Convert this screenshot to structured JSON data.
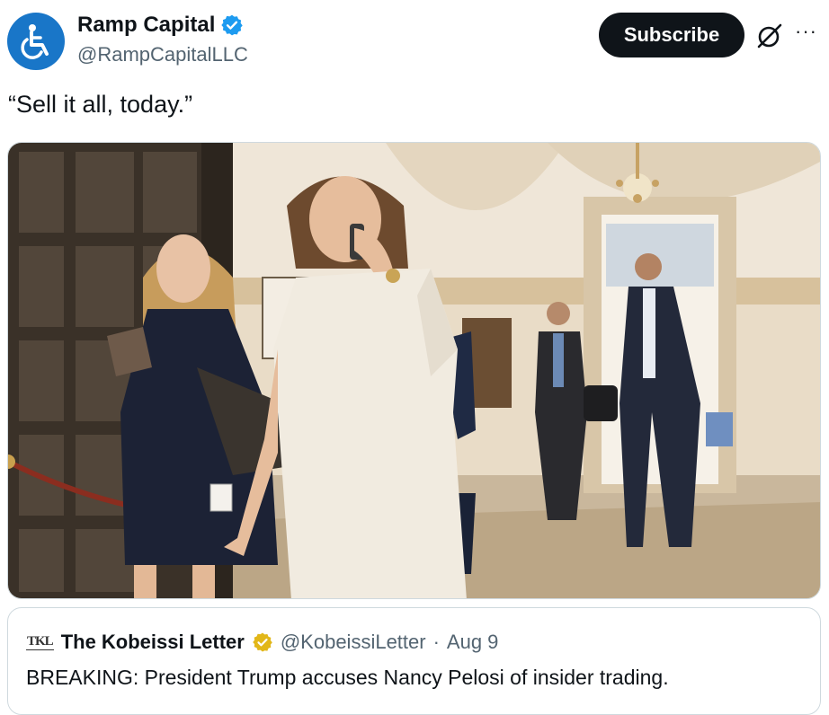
{
  "author": {
    "display_name": "Ramp Capital",
    "handle": "@RampCapitalLLC",
    "avatar_icon": "wheelchair-icon",
    "avatar_color": "#1976c8",
    "verified_color": "#1d9bf0"
  },
  "actions": {
    "subscribe_label": "Subscribe",
    "more_label": "···"
  },
  "tweet": {
    "text": "“Sell it all, today.”"
  },
  "media": {
    "kind": "photo"
  },
  "quote": {
    "logo_text": "TKL",
    "display_name": "The Kobeissi Letter",
    "handle": "@KobeissiLetter",
    "separator": "·",
    "date": "Aug 9",
    "text": "BREAKING: President Trump accuses Nancy Pelosi of insider trading.",
    "badge_color": "#e2b719"
  }
}
